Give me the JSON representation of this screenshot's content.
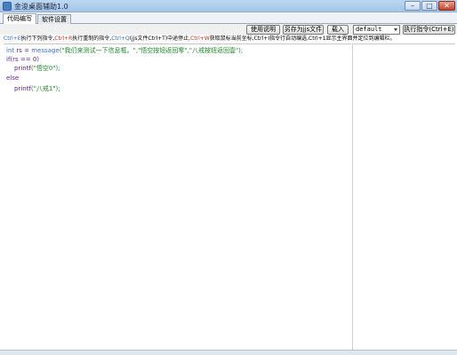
{
  "window": {
    "title": "金浚桌面辅助1.0",
    "buttons": {
      "minimize": "–",
      "maximize": "□",
      "close": "✕"
    }
  },
  "tabs": [
    {
      "label": "代码编写",
      "active": true
    },
    {
      "label": "软件设置",
      "active": false
    }
  ],
  "toolbar": {
    "help_label": "使用说明",
    "save_as_label": "另存为jjs文件",
    "load_label": "载入",
    "select_value": "default",
    "run_label": "执行指令(Ctrl+E)"
  },
  "hint": {
    "part1": "Ctrl+E",
    "part2": "执行下列指令,",
    "part3": "Ctrl+R",
    "part4": "执行重制的指令,",
    "part5": "Ctrl+Q",
    "part6": "(jjs文件Ctrl+T)中途停止,",
    "part7": "Ctrl+W",
    "part8": "获取鼠标当前坐标,Ctrl+I指令行自动编选,Ctrl+1显示主界面并定位到编辑栏。"
  },
  "code": {
    "line1_kw": "int",
    "line1_a": " rs = ",
    "line1_fn": "message",
    "line1_str": "(\"我们来测试一下信息框。\",\"悟空按钮返回零\",\"八戒按钮返回壹\");",
    "line2": "if(rs == 0)",
    "line3_fn": "printf",
    "line3_str": "(\"悟空0\");",
    "line4": "else",
    "line5_fn": "printf",
    "line5_str": "(\"八戒1\");"
  },
  "colors": {
    "keyword": "#3a6fc7",
    "string": "#1e8a2a",
    "plain": "#5a1f8a",
    "hint_blue": "#2d6fc0",
    "hint_red": "#c03020"
  }
}
